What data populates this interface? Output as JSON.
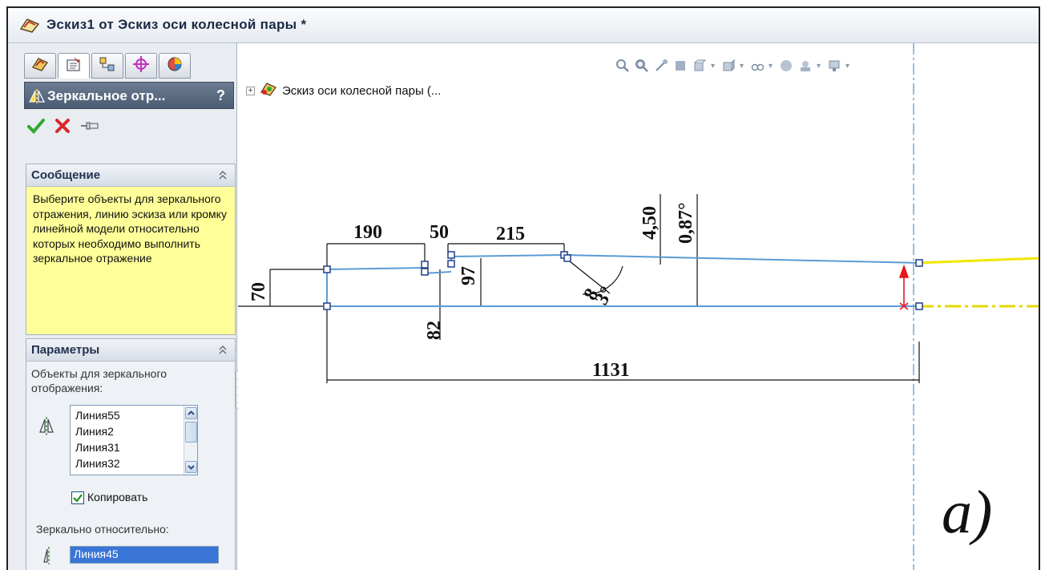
{
  "window": {
    "title": "Эскиз1 от Эскиз оси колесной пары *"
  },
  "panel": {
    "tabs": [
      "feature-manager",
      "property-manager",
      "configuration-manager",
      "dimxpert-manager",
      "display-manager"
    ],
    "header_title": "Зеркальное отр...",
    "help_label": "?",
    "message_group": {
      "title": "Сообщение",
      "text": "Выберите объекты для зеркального отражения, линию эскиза или кромку линейной модели относительно которых необходимо выполнить зеркальное отражение"
    },
    "params_group": {
      "title": "Параметры",
      "entities_label": "Объекты для зеркального отображения:",
      "entities": [
        "Линия55",
        "Линия2",
        "Линия31",
        "Линия32"
      ],
      "copy_label": "Копировать",
      "copy_checked": true,
      "mirror_about_label": "Зеркально относительно:",
      "mirror_about_value": "Линия45"
    }
  },
  "graphics": {
    "tree_item": "Эскиз оси колесной пары  (...",
    "dimensions": {
      "d190": "190",
      "d50": "50",
      "d215": "215",
      "d450": "4,50",
      "d087": "0,87°",
      "d70": "70",
      "d97": "97",
      "d3": "3°",
      "d8": "8",
      "d82": "82",
      "d1131": "1131"
    },
    "figure_label": "a)"
  },
  "colors": {
    "sketch_line": "#5b9bd5",
    "yellow_line": "#f2e600",
    "arrow": "#e8151b",
    "message_bg": "#ffff99",
    "selection": "#3875d7"
  }
}
